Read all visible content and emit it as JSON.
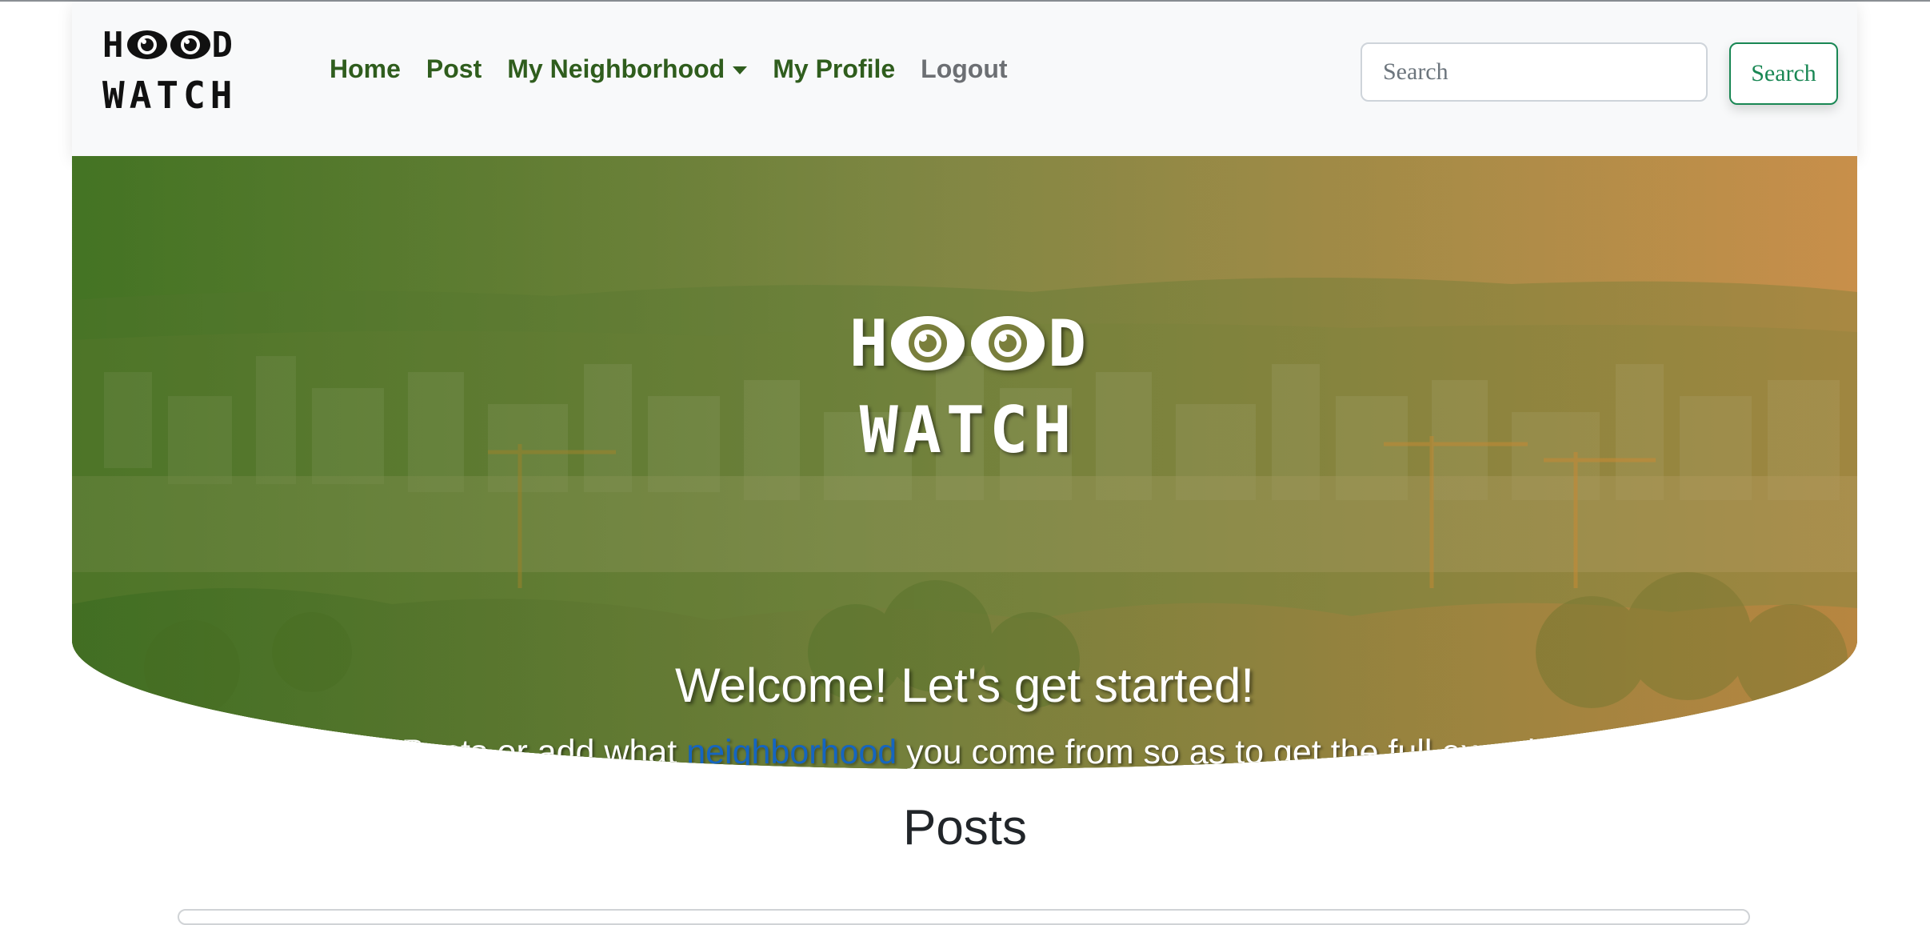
{
  "brand": {
    "line1_left": "H",
    "line1_right": "D",
    "line2": "WATCH"
  },
  "nav": {
    "items": [
      {
        "label": "Home"
      },
      {
        "label": "Post"
      },
      {
        "label": "My Neighborhood"
      },
      {
        "label": "My Profile"
      },
      {
        "label": "Logout"
      }
    ]
  },
  "search": {
    "placeholder": "Search",
    "button_label": "Search"
  },
  "hero": {
    "logo_line1_left": "H",
    "logo_line1_right": "D",
    "logo_line2": "WATCH",
    "title": "Welcome! Let's get started!",
    "subtitle_before": "Read Posts or add what ",
    "subtitle_link": "neighborhood",
    "subtitle_after": " you come from so as to get the full experience."
  },
  "posts": {
    "heading": "Posts"
  },
  "colors": {
    "nav_link": "#2f5d1d",
    "nav_link_muted": "#6c6f73",
    "search_button": "#198754",
    "hero_gradient_start": "#4e7a2c",
    "hero_gradient_end": "#c48b48",
    "link": "#1565c0"
  }
}
